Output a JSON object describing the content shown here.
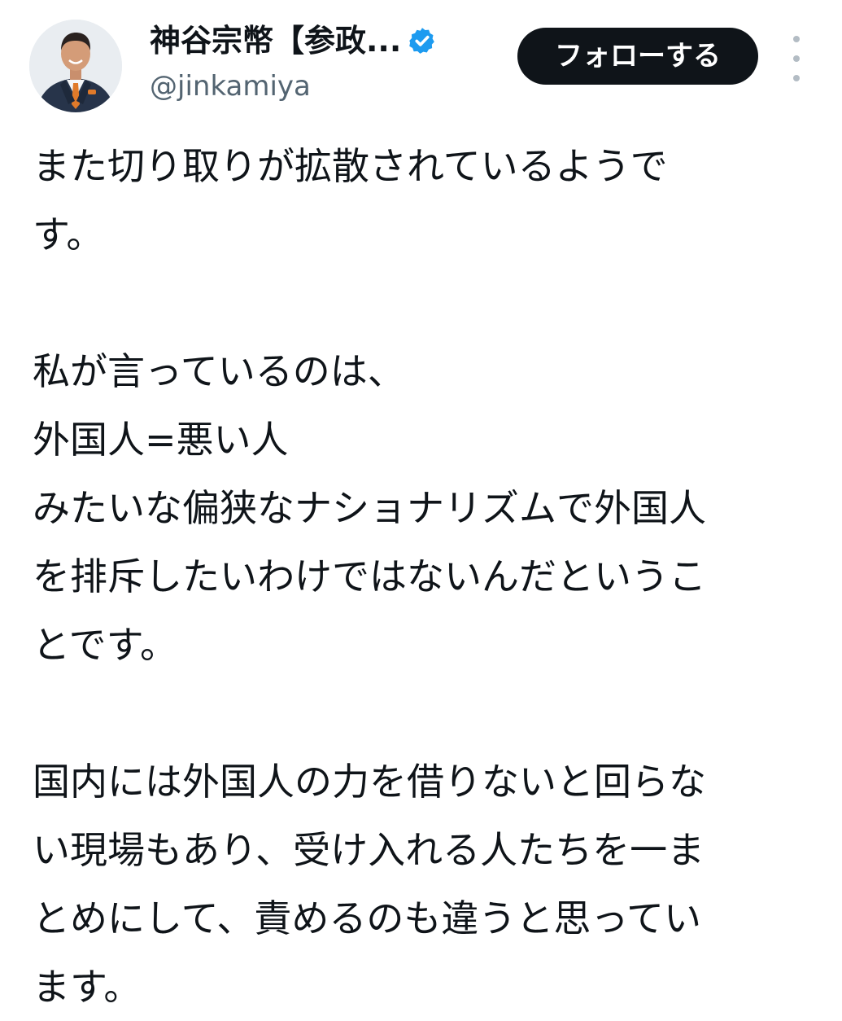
{
  "author": {
    "display_name": "神谷宗幣【参政...",
    "handle": "@jinkamiya",
    "verified": true,
    "avatar_icon": "profile-photo"
  },
  "actions": {
    "follow_label": "フォローする",
    "more_icon": "more-vertical-icon"
  },
  "tweet": {
    "paragraphs": [
      [
        "また切り取りが拡散されているようで",
        "す。"
      ],
      [
        "私が言っているのは、",
        "外国人=悪い人",
        "みたいな偏狭なナショナリズムで外国人",
        "を排斥したいわけではないんだというこ",
        "とです。"
      ],
      [
        "国内には外国人の力を借りないと回らな",
        "い現場もあり、受け入れる人たちを一ま",
        "とめにして、責めるのも違うと思ってい",
        "ます。"
      ]
    ]
  },
  "colors": {
    "text": "#0f1419",
    "secondary_text": "#536471",
    "follow_button_bg": "#0f1419",
    "follow_button_text": "#ffffff",
    "verified_badge": "#1d9bf0",
    "background": "#ffffff"
  }
}
